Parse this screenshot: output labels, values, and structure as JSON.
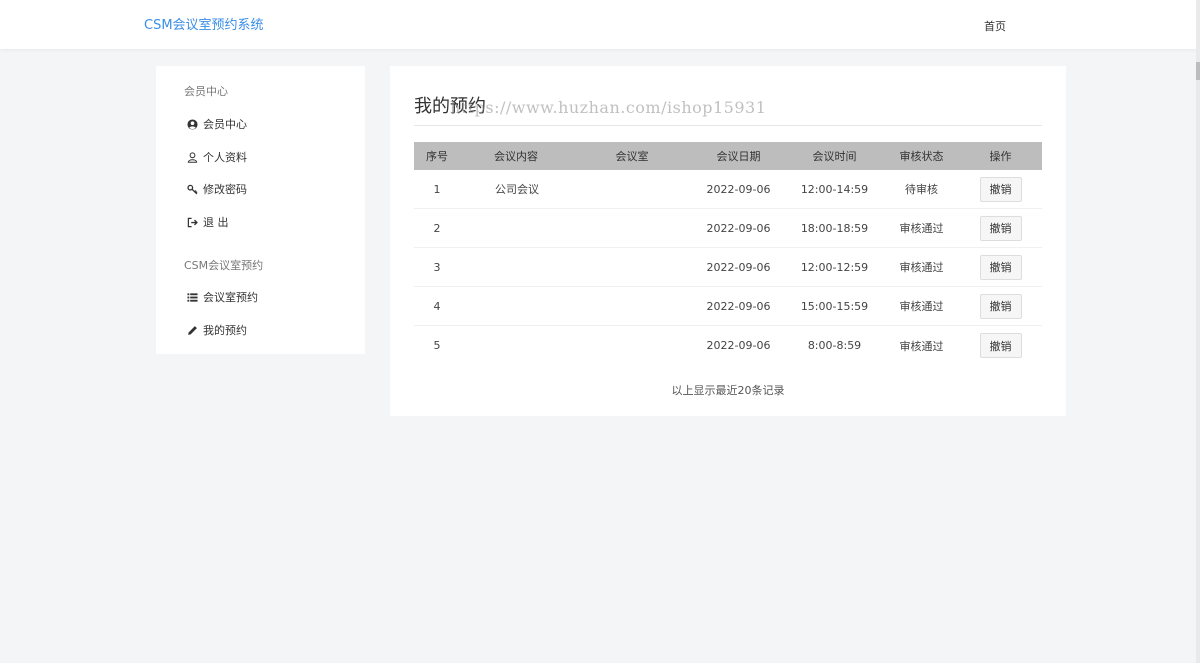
{
  "header": {
    "brand": "CSM会议室预约系统",
    "nav_home": "首页"
  },
  "sidebar": {
    "groups": [
      {
        "title": "会员中心",
        "items": [
          {
            "label": "会员中心",
            "icon": "user-circle-icon"
          },
          {
            "label": "个人资料",
            "icon": "user-outline-icon"
          },
          {
            "label": "修改密码",
            "icon": "key-icon"
          },
          {
            "label": "退 出",
            "icon": "logout-icon"
          }
        ]
      },
      {
        "title": "CSM会议室预约",
        "items": [
          {
            "label": "会议室预约",
            "icon": "list-icon"
          },
          {
            "label": "我的预约",
            "icon": "pencil-icon"
          }
        ]
      }
    ]
  },
  "main": {
    "title": "我的预约",
    "watermark": "https://www.huzhan.com/ishop15931",
    "table": {
      "headers": [
        "序号",
        "会议内容",
        "会议室",
        "会议日期",
        "会议时间",
        "审核状态",
        "操作"
      ],
      "rows": [
        {
          "seq": "1",
          "content": "公司会议",
          "room": "",
          "date": "2022-09-06",
          "time": "12:00-14:59",
          "status": "待审核",
          "action": "撤销"
        },
        {
          "seq": "2",
          "content": "",
          "room": "",
          "date": "2022-09-06",
          "time": "18:00-18:59",
          "status": "审核通过",
          "action": "撤销"
        },
        {
          "seq": "3",
          "content": "",
          "room": "",
          "date": "2022-09-06",
          "time": "12:00-12:59",
          "status": "审核通过",
          "action": "撤销"
        },
        {
          "seq": "4",
          "content": "",
          "room": "",
          "date": "2022-09-06",
          "time": "15:00-15:59",
          "status": "审核通过",
          "action": "撤销"
        },
        {
          "seq": "5",
          "content": "",
          "room": "",
          "date": "2022-09-06",
          "time": "8:00-8:59",
          "status": "审核通过",
          "action": "撤销"
        }
      ]
    },
    "footer_note": "以上显示最近20条记录"
  },
  "colors": {
    "brand": "#3a8ee6",
    "header_row": "#bdbdbd",
    "page_bg": "#f4f5f7"
  }
}
